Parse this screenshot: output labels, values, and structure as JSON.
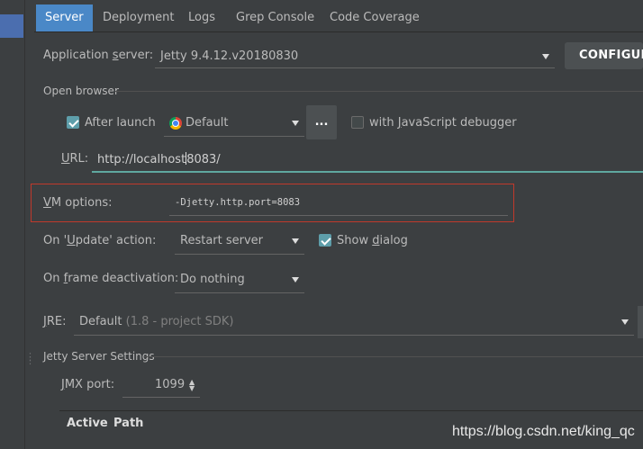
{
  "tabs": [
    {
      "label": "Server",
      "active": true
    },
    {
      "label": "Deployment",
      "active": false
    },
    {
      "label": "Logs",
      "active": false
    },
    {
      "label": "Grep Console",
      "active": false
    },
    {
      "label": "Code Coverage",
      "active": false
    }
  ],
  "app_server": {
    "label_pre": "Application ",
    "label_mnemonic": "s",
    "label_post": "erver:",
    "value": "Jetty 9.4.12.v20180830",
    "configure_label": "CONFIGURE..."
  },
  "open_browser": {
    "section_title": "Open browser",
    "after_launch_label": "After launch",
    "after_launch_checked": true,
    "browser_value": "Default",
    "dots_label": "...",
    "js_debugger_pre": "with ",
    "js_debugger_mnemonic": "J",
    "js_debugger_post": "avaScript debugger",
    "js_debugger_checked": false,
    "url_label_mnemonic": "U",
    "url_label_post": "RL:",
    "url_before_caret": "http://localhost",
    "url_after_caret": "8083/"
  },
  "vm_options": {
    "label_mnemonic": "V",
    "label_post": "M options:",
    "value": "-Djetty.http.port=8083"
  },
  "on_update": {
    "label_pre": "On '",
    "label_mnemonic": "U",
    "label_post": "pdate' action:",
    "value": "Restart server",
    "show_dialog_pre": "Show ",
    "show_dialog_mnemonic": "d",
    "show_dialog_post": "ialog",
    "show_dialog_checked": true
  },
  "on_frame": {
    "label_pre": "On ",
    "label_mnemonic": "f",
    "label_post": "rame deactivation:",
    "value": "Do nothing"
  },
  "jre": {
    "label_mnemonic": "J",
    "label_post": "RE:",
    "value": "Default",
    "hint": "(1.8 - project SDK)"
  },
  "jetty_settings": {
    "section_title": "Jetty Server Settings",
    "jmx_label_mnemonic": "J",
    "jmx_label_post": "MX port:",
    "jmx_port": "1099",
    "columns": [
      "Active",
      "Path"
    ]
  },
  "watermark": "https://blog.csdn.net/king_qc",
  "colors": {
    "background": "#3c3f41",
    "active_tab": "#4a88c7",
    "checkbox": "#5e9eaa",
    "highlight_box": "#c0392b",
    "url_focus": "#5fa8a0"
  }
}
